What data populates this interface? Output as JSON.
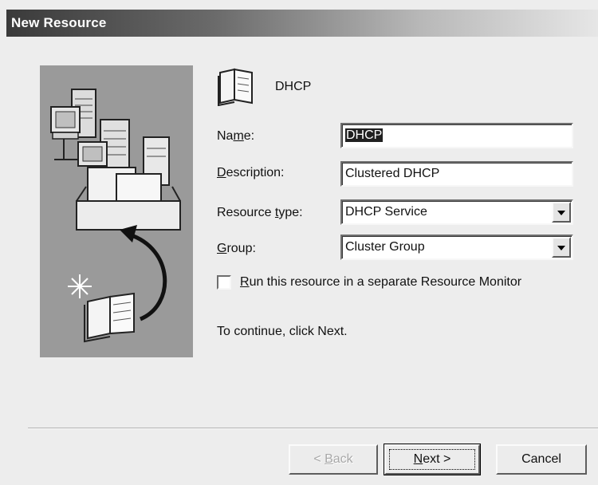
{
  "window": {
    "title": "New Resource"
  },
  "resource": {
    "name": "DHCP",
    "icon": "book-icon"
  },
  "form": {
    "name_label_pre": "Na",
    "name_label_accel": "m",
    "name_label_post": "e:",
    "name_value": "DHCP",
    "description_label_accel": "D",
    "description_label_post": "escription:",
    "description_value": "Clustered DHCP",
    "resource_type_label_pre": "Resource ",
    "resource_type_label_accel": "t",
    "resource_type_label_post": "ype:",
    "resource_type_value": "DHCP Service",
    "group_label_accel": "G",
    "group_label_post": "roup:",
    "group_value": "Cluster Group",
    "monitor_checkbox_accel": "R",
    "monitor_checkbox_post": "un this resource in a separate Resource Monitor",
    "monitor_checked": false
  },
  "hint": "To continue, click Next.",
  "buttons": {
    "back_accel": "< ",
    "back_u": "B",
    "back_post": "ack",
    "next_u": "N",
    "next_post": "ext >",
    "cancel": "Cancel"
  },
  "colors": {
    "art_background": "#9a9a9a",
    "dialog_background": "#ededed"
  }
}
